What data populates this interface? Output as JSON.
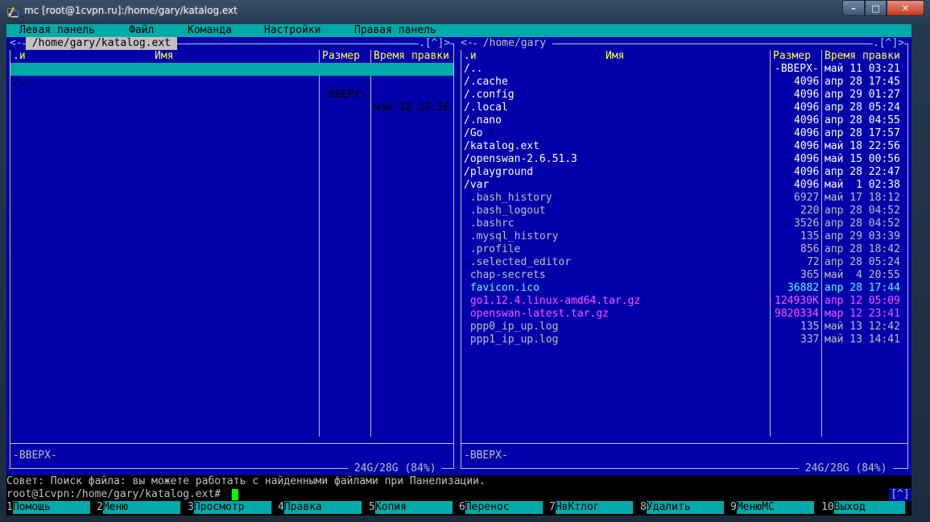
{
  "window": {
    "title": "mc [root@1cvpn.ru]:/home/gary/katalog.ext",
    "min": "–",
    "max": "□",
    "close": "✕"
  },
  "menubar": [
    "Левая панель",
    "Файл",
    "Команда",
    "Настройки",
    "Правая панель"
  ],
  "left_panel": {
    "path": " /home/gary/katalog.ext ",
    "corner": ".[^]>",
    "left_marker": "<-",
    "headers": {
      "name_flag": ".и",
      "name": "Имя",
      "size": "Размер",
      "time": "Время правки"
    },
    "rows": [
      {
        "name": "/..",
        "size": "-ВВЕРХ-",
        "time": "май 18 22:56",
        "selected": true
      }
    ],
    "status": "-ВВЕРХ-",
    "disk": " 24G/28G (84%) "
  },
  "right_panel": {
    "path": " /home/gary ",
    "corner": ".[^]>",
    "left_marker": "<-",
    "headers": {
      "name_flag": ".и",
      "name": "Имя",
      "size": "Размер",
      "time": "Время правки"
    },
    "rows": [
      {
        "name": "/..",
        "size": "-ВВЕРХ-",
        "time": "май 11 03:21",
        "kind": "dir"
      },
      {
        "name": "/.cache",
        "size": "4096",
        "time": "апр 28 17:45",
        "kind": "dir"
      },
      {
        "name": "/.config",
        "size": "4096",
        "time": "апр 29 01:27",
        "kind": "dir"
      },
      {
        "name": "/.local",
        "size": "4096",
        "time": "апр 28 05:24",
        "kind": "dir"
      },
      {
        "name": "/.nano",
        "size": "4096",
        "time": "апр 28 04:55",
        "kind": "dir"
      },
      {
        "name": "/Go",
        "size": "4096",
        "time": "апр 28 17:57",
        "kind": "dir"
      },
      {
        "name": "/katalog.ext",
        "size": "4096",
        "time": "май 18 22:56",
        "kind": "dir"
      },
      {
        "name": "/openswan-2.6.51.3",
        "size": "4096",
        "time": "май 15 00:56",
        "kind": "dir"
      },
      {
        "name": "/playground",
        "size": "4096",
        "time": "апр 28 22:47",
        "kind": "dir"
      },
      {
        "name": "/var",
        "size": "4096",
        "time": "май  1 02:38",
        "kind": "dir"
      },
      {
        "name": " .bash_history",
        "size": "6927",
        "time": "май 17 18:12",
        "kind": "file"
      },
      {
        "name": " .bash_logout",
        "size": "220",
        "time": "апр 28 04:52",
        "kind": "file"
      },
      {
        "name": " .bashrc",
        "size": "3526",
        "time": "апр 28 04:52",
        "kind": "file"
      },
      {
        "name": " .mysql_history",
        "size": "135",
        "time": "апр 29 03:39",
        "kind": "file"
      },
      {
        "name": " .profile",
        "size": "856",
        "time": "апр 28 18:42",
        "kind": "file"
      },
      {
        "name": " .selected_editor",
        "size": "72",
        "time": "апр 28 05:24",
        "kind": "file"
      },
      {
        "name": " chap-secrets",
        "size": "365",
        "time": "май  4 20:55",
        "kind": "file"
      },
      {
        "name": " favicon.ico",
        "size": "36882",
        "time": "апр 28 17:44",
        "kind": "img"
      },
      {
        "name": " go1.12.4.linux-amd64.tar.gz",
        "size": "124930K",
        "time": "апр 12 05:09",
        "kind": "arch"
      },
      {
        "name": " openswan-latest.tar.gz",
        "size": "9820334",
        "time": "мар 12 23:41",
        "kind": "arch"
      },
      {
        "name": " ppp0_ip_up.log",
        "size": "135",
        "time": "май 13 12:42",
        "kind": "file"
      },
      {
        "name": " ppp1_ip_up.log",
        "size": "337",
        "time": "май 13 14:41",
        "kind": "file"
      }
    ],
    "status": "-ВВЕРХ-",
    "disk": " 24G/28G (84%) "
  },
  "hint": "Совет: Поиск файла: вы можете работать с найденными файлами при Панелизации.",
  "prompt": "root@1cvpn:/home/gary/katalog.ext#",
  "corner_button": "[^]",
  "fkeys": [
    {
      "num": "1",
      "label": "Помощь"
    },
    {
      "num": "2",
      "label": "Меню"
    },
    {
      "num": "3",
      "label": "Просмотр"
    },
    {
      "num": "4",
      "label": "Правка"
    },
    {
      "num": "5",
      "label": "Копия"
    },
    {
      "num": "6",
      "label": "Перенос"
    },
    {
      "num": "7",
      "label": "НвКтлог"
    },
    {
      "num": "8",
      "label": "Удалить"
    },
    {
      "num": "9",
      "label": "МенюMC"
    },
    {
      "num": "10",
      "label": "Выход"
    }
  ],
  "colors": {
    "panel_bg": "#0000aa",
    "menu_bg": "#00aaaa",
    "directory": "#ffffff",
    "file": "#c0c0c0",
    "image": "#55ffff",
    "archive": "#ff55ff",
    "header": "#ffff55",
    "cursor": "#00ff00"
  }
}
